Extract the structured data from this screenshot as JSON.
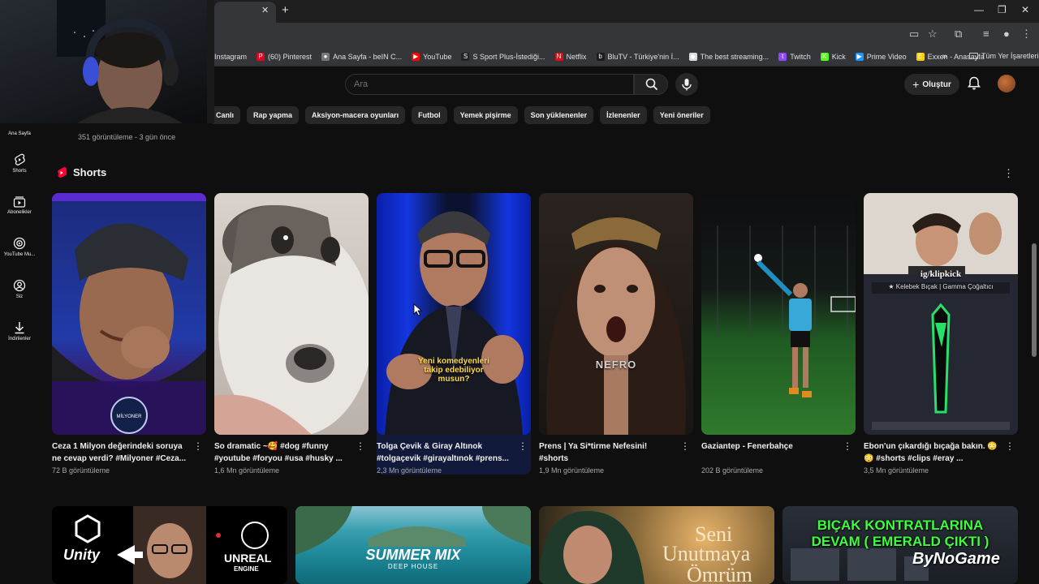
{
  "bookmarks": [
    {
      "label": "Instagram",
      "color": "#35363a",
      "glyph": ""
    },
    {
      "label": "(60) Pinterest",
      "color": "#e60023",
      "glyph": "P"
    },
    {
      "label": "Ana Sayfa - beIN C...",
      "color": "#777777",
      "glyph": "●"
    },
    {
      "label": "YouTube",
      "color": "#ff0000",
      "glyph": "▶"
    },
    {
      "label": "S Sport Plus-İstediği...",
      "color": "#222222",
      "glyph": "S"
    },
    {
      "label": "Netflix",
      "color": "#e50914",
      "glyph": "N"
    },
    {
      "label": "BluTV - Türkiye'nin İ...",
      "color": "#1a1a1a",
      "glyph": "b"
    },
    {
      "label": "The best streaming...",
      "color": "#dddddd",
      "glyph": "◆"
    },
    {
      "label": "Twitch",
      "color": "#9146ff",
      "glyph": "t"
    },
    {
      "label": "Kick",
      "color": "#53fc18",
      "glyph": "K"
    },
    {
      "label": "Prime Video",
      "color": "#1a98ff",
      "glyph": "▶"
    },
    {
      "label": "Exxen - Anasayfa",
      "color": "#f5d000",
      "glyph": "E"
    }
  ],
  "bookmarks_all": "Tüm Yer İşaretleri",
  "search": {
    "placeholder": "Ara"
  },
  "header": {
    "create_label": "Oluştur"
  },
  "chips": [
    "Canlı",
    "Rap yapma",
    "Aksiyon-macera oyunları",
    "Futbol",
    "Yemek pişirme",
    "Son yüklenenler",
    "İzlenenler",
    "Yeni öneriler"
  ],
  "prev_video_meta": "351 görüntüleme - 3 gün önce",
  "sidebar": [
    {
      "label": "Ana Sayfa",
      "icon": "home-icon"
    },
    {
      "label": "Shorts",
      "icon": "shorts-icon"
    },
    {
      "label": "Abonelikler",
      "icon": "subscriptions-icon"
    },
    {
      "label": "YouTube Mu...",
      "icon": "music-icon"
    },
    {
      "label": "Siz",
      "icon": "you-icon"
    },
    {
      "label": "İndirilenler",
      "icon": "download-icon"
    }
  ],
  "shorts_section": {
    "title": "Shorts"
  },
  "shorts": [
    {
      "title": "Ceza 1 Milyon değerindeki soruya ne cevap verdi? #Milyoner #Ceza...",
      "views": "72 B görüntüleme"
    },
    {
      "title": "So dramatic ~🥰 #dog #funny #youtube #foryou #usa #husky ...",
      "views": "1,6 Mn görüntüleme"
    },
    {
      "title": "Tolga Çevik & Giray Altınok #tolgaçevik #girayaltınok #prens...",
      "views": "2,3 Mn görüntüleme",
      "caption": "Yeni komedyenleri takip edebiliyor musun?"
    },
    {
      "title": "Prens | Ya Si*tirme Nefesini! #shorts",
      "views": "1,9 Mn görüntüleme",
      "caption": "NEFRO"
    },
    {
      "title": "Gaziantep - Fenerbahçe",
      "views": "202 B görüntüleme"
    },
    {
      "title": "Ebon'un çıkardığı bıçağa bakın. 😳😳 #shorts #clips #eray ...",
      "views": "3,5 Mn görüntüleme",
      "caption": "ig/klipkick",
      "subcaption": "★ Kelebek Bıçak | Gamma Çoğaltıcı"
    }
  ],
  "videos": [
    {
      "text1": "Unity",
      "text2": "UNREAL",
      "text3": "ENGINE"
    },
    {
      "text1": "SUMMER MIX",
      "text2": "DEEP HOUSE"
    },
    {
      "text1": "Seni",
      "text2": "Unutmaya",
      "text3": "Ömrüm"
    },
    {
      "text1": "BIÇAK KONTRATLARINA",
      "text2": "DEVAM ( EMERALD ÇIKTI )",
      "text3": "ByNoGame"
    }
  ]
}
